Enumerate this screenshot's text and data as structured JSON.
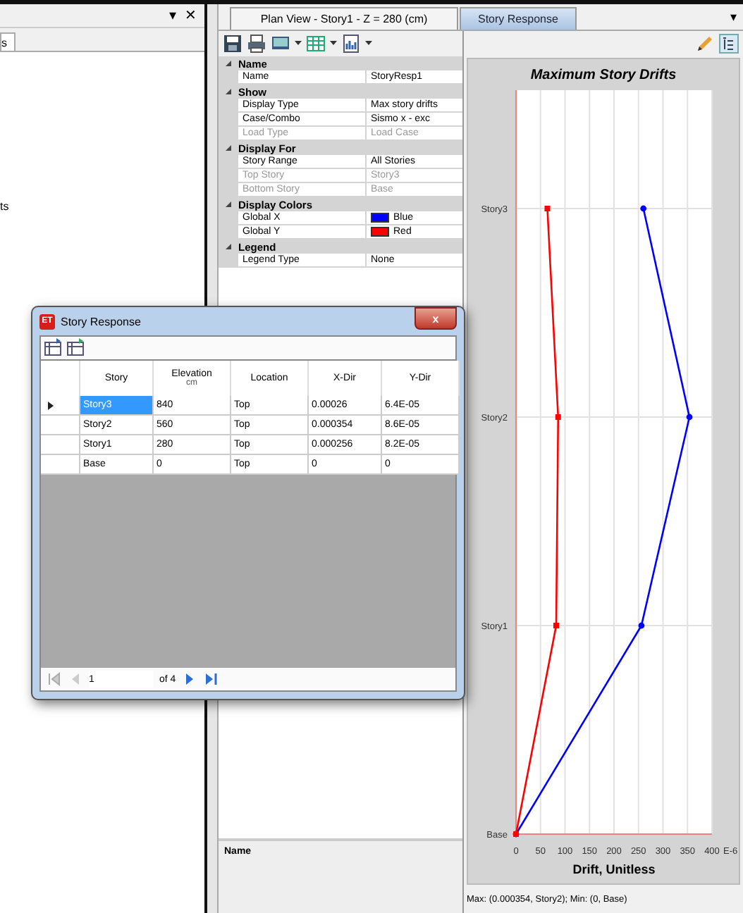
{
  "left_panel": {
    "header_buttons": [
      "▾",
      "✕"
    ],
    "tab": {
      "label": "s",
      "selected": true
    },
    "items": [
      "ts"
    ]
  },
  "document_tabs": [
    {
      "label": "Plan View - Story1 - Z = 280 (cm)",
      "selected": false
    },
    {
      "label": "Story Response",
      "selected": true
    }
  ],
  "tab_menu": "▾",
  "properties": [
    {
      "category": "Name",
      "expanded": true,
      "rows": [
        {
          "name": "Name",
          "value": "StoryResp1",
          "disabled": false
        }
      ]
    },
    {
      "category": "Show",
      "expanded": true,
      "rows": [
        {
          "name": "Display Type",
          "value": "Max story drifts",
          "disabled": false
        },
        {
          "name": "Case/Combo",
          "value": "Sismo x - exc",
          "disabled": false
        },
        {
          "name": "Load Type",
          "value": "Load Case",
          "disabled": true
        }
      ]
    },
    {
      "category": "Display For",
      "expanded": true,
      "rows": [
        {
          "name": "Story Range",
          "value": "All Stories",
          "disabled": false
        },
        {
          "name": "Top Story",
          "value": "Story3",
          "disabled": true
        },
        {
          "name": "Bottom Story",
          "value": "Base",
          "disabled": true
        }
      ]
    },
    {
      "category": "Display Colors",
      "expanded": true,
      "rows": [
        {
          "name": "Global X",
          "value": "Blue",
          "color": "#0000ff",
          "disabled": false
        },
        {
          "name": "Global Y",
          "value": "Red",
          "color": "#ff0000",
          "disabled": false
        }
      ]
    },
    {
      "category": "Legend",
      "expanded": true,
      "rows": [
        {
          "name": "Legend Type",
          "value": "None",
          "disabled": false
        }
      ]
    }
  ],
  "description": {
    "title": "Name"
  },
  "chart": {
    "chart_data": {
      "type": "line",
      "title": "Maximum Story Drifts",
      "xlabel": "Drift, Unitless",
      "categories": [
        "Story3",
        "Story2",
        "Story1",
        "Base"
      ],
      "orientation": "horizontal",
      "grid": true,
      "xlim": [
        0,
        400
      ],
      "xticks": [
        0,
        50,
        100,
        150,
        200,
        250,
        300,
        350,
        400
      ],
      "series": [
        {
          "color": "#0000ff",
          "marker": "circle",
          "values": [
            260,
            354,
            256,
            0
          ]
        },
        {
          "color": "#ff0000",
          "marker": "square",
          "values": [
            64,
            86,
            82,
            0
          ]
        }
      ]
    },
    "scale_label": "E-6"
  },
  "status_bar": "Max: (0.000354, Story2);   Min: (0, Base)",
  "dialog": {
    "badge": "ET",
    "title": "Story Response",
    "close": "x",
    "columns": [
      {
        "label": "Story"
      },
      {
        "label": "Elevation",
        "unit": "cm"
      },
      {
        "label": "Location"
      },
      {
        "label": "X-Dir"
      },
      {
        "label": "Y-Dir"
      }
    ],
    "rows": [
      {
        "selected": true,
        "cells": [
          "Story3",
          "840",
          "Top",
          "0.00026",
          "6.4E-05"
        ]
      },
      {
        "selected": false,
        "cells": [
          "Story2",
          "560",
          "Top",
          "0.000354",
          "8.6E-05"
        ]
      },
      {
        "selected": false,
        "cells": [
          "Story1",
          "280",
          "Top",
          "0.000256",
          "8.2E-05"
        ]
      },
      {
        "selected": false,
        "cells": [
          "Base",
          "0",
          "Top",
          "0",
          "0"
        ]
      }
    ],
    "pager": {
      "page": "1",
      "total": "of 4"
    }
  }
}
